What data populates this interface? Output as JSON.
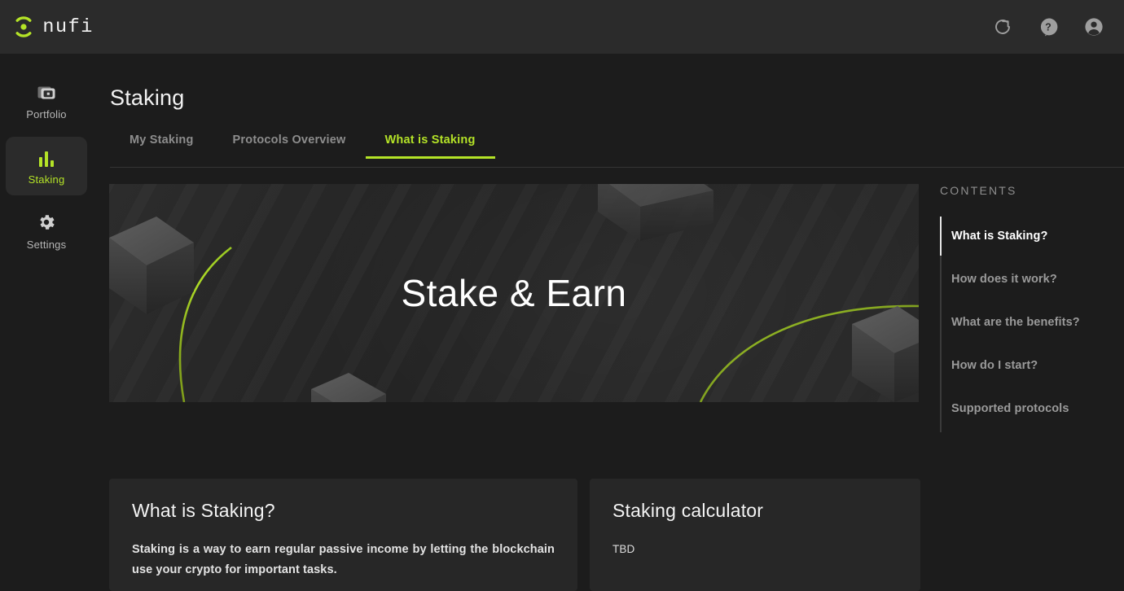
{
  "header": {
    "brand_word": "nufi",
    "brand_icon": "nufi-logo-icon",
    "actions": [
      {
        "name": "refresh-icon",
        "label": "Refresh"
      },
      {
        "name": "help-icon",
        "label": "Help"
      },
      {
        "name": "account-icon",
        "label": "Account"
      }
    ]
  },
  "sidebar": {
    "items": [
      {
        "label": "Portfolio",
        "icon": "wallet-icon",
        "active": false
      },
      {
        "label": "Staking",
        "icon": "bar-chart-icon",
        "active": true
      },
      {
        "label": "Settings",
        "icon": "gear-icon",
        "active": false
      }
    ]
  },
  "main": {
    "page_title": "Staking",
    "tabs": [
      {
        "label": "My Staking",
        "active": false
      },
      {
        "label": "Protocols Overview",
        "active": false
      },
      {
        "label": "What is Staking",
        "active": true
      }
    ],
    "hero": {
      "title": "Stake & Earn"
    },
    "cards": [
      {
        "title": "What is Staking?",
        "body": "Staking is a way to earn regular passive income by letting the blockchain use your crypto for important tasks."
      },
      {
        "title": "Staking calculator",
        "body": "TBD"
      }
    ]
  },
  "toc": {
    "heading": "CONTENTS",
    "items": [
      {
        "label": "What is Staking?",
        "active": true
      },
      {
        "label": "How does it work?",
        "active": false
      },
      {
        "label": "What are the benefits?",
        "active": false
      },
      {
        "label": "How do I start?",
        "active": false
      },
      {
        "label": "Supported protocols",
        "active": false
      }
    ]
  },
  "colors": {
    "accent_green": "#b4e327",
    "header_bg": "#2b2b2b",
    "page_bg": "#1c1c1c",
    "card_bg": "#272727",
    "text_primary": "#f2f2f2",
    "text_muted": "#8d8d8d"
  }
}
